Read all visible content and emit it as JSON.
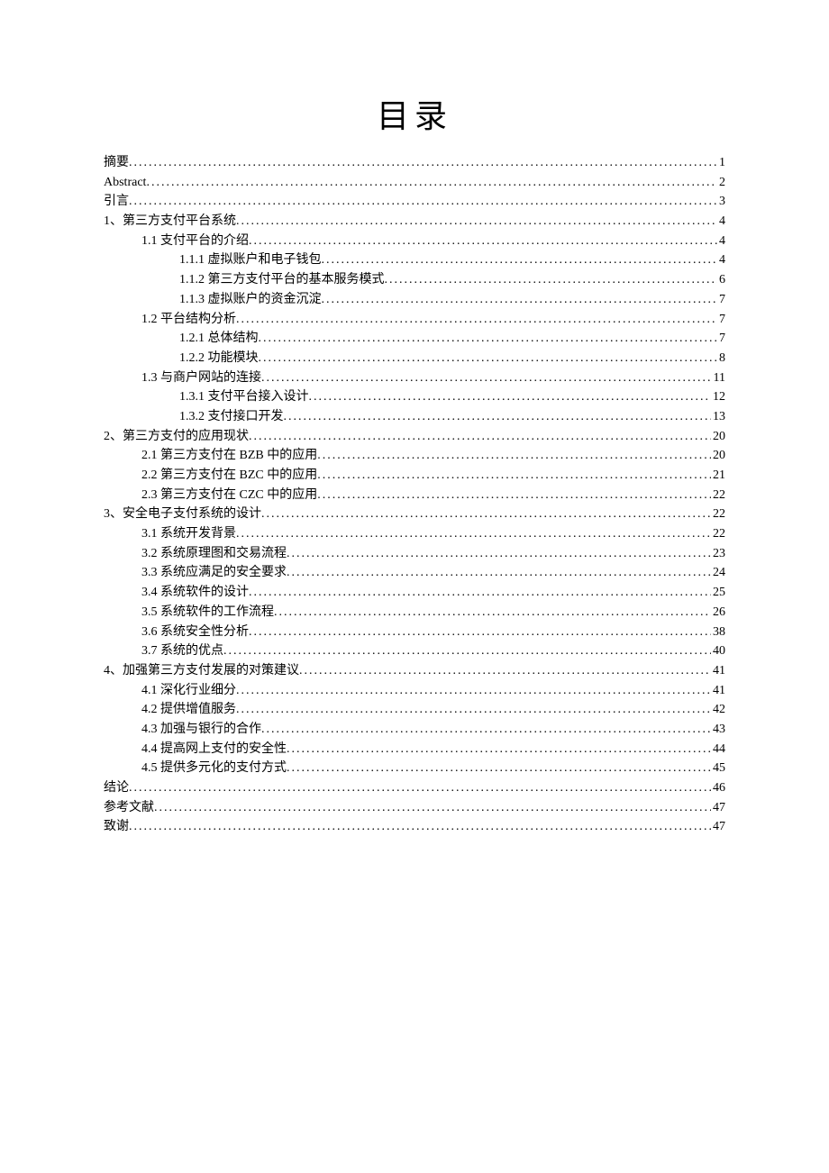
{
  "title": "目录",
  "entries": [
    {
      "label": "摘要",
      "page": "1",
      "level": 0
    },
    {
      "label": "Abstract",
      "page": "2",
      "level": 0
    },
    {
      "label": "引言",
      "page": "3",
      "level": 0
    },
    {
      "label": "1、第三方支付平台系统",
      "page": "4",
      "level": 0
    },
    {
      "label": "1.1 支付平台的介绍",
      "page": "4",
      "level": 1
    },
    {
      "label": "1.1.1 虚拟账户和电子钱包",
      "page": "4",
      "level": 2
    },
    {
      "label": "1.1.2 第三方支付平台的基本服务模式",
      "page": "6",
      "level": 2
    },
    {
      "label": "1.1.3 虚拟账户的资金沉淀",
      "page": "7",
      "level": 2
    },
    {
      "label": "1.2 平台结构分析",
      "page": "7",
      "level": 1
    },
    {
      "label": "1.2.1 总体结构",
      "page": "7",
      "level": 2
    },
    {
      "label": "1.2.2 功能模块",
      "page": "8",
      "level": 2
    },
    {
      "label": "1.3 与商户网站的连接",
      "page": "11",
      "level": 1
    },
    {
      "label": "1.3.1 支付平台接入设计",
      "page": "12",
      "level": 2
    },
    {
      "label": "1.3.2 支付接口开发",
      "page": "13",
      "level": 2
    },
    {
      "label": "2、第三方支付的应用现状",
      "page": "20",
      "level": 0
    },
    {
      "label": "2.1 第三方支付在 BZB 中的应用",
      "page": "20",
      "level": 1
    },
    {
      "label": "2.2 第三方支付在 BZC 中的应用",
      "page": "21",
      "level": 1
    },
    {
      "label": "2.3 第三方支付在 CZC 中的应用",
      "page": "22",
      "level": 1
    },
    {
      "label": "3、安全电子支付系统的设计",
      "page": "22",
      "level": 0
    },
    {
      "label": "3.1 系统开发背景",
      "page": "22",
      "level": 1
    },
    {
      "label": "3.2 系统原理图和交易流程",
      "page": "23",
      "level": 1
    },
    {
      "label": "3.3 系统应满足的安全要求",
      "page": "24",
      "level": 1
    },
    {
      "label": "3.4 系统软件的设计",
      "page": "25",
      "level": 1
    },
    {
      "label": "3.5 系统软件的工作流程",
      "page": "26",
      "level": 1
    },
    {
      "label": "3.6 系统安全性分析",
      "page": "38",
      "level": 1
    },
    {
      "label": "3.7 系统的优点",
      "page": "40",
      "level": 1
    },
    {
      "label": "4、加强第三方支付发展的对策建议",
      "page": "41",
      "level": 0
    },
    {
      "label": "4.1 深化行业细分",
      "page": "41",
      "level": 1
    },
    {
      "label": "4.2 提供增值服务",
      "page": "42",
      "level": 1
    },
    {
      "label": "4.3 加强与银行的合作",
      "page": "43",
      "level": 1
    },
    {
      "label": "4.4 提高网上支付的安全性",
      "page": "44",
      "level": 1
    },
    {
      "label": "4.5 提供多元化的支付方式",
      "page": "45",
      "level": 1
    },
    {
      "label": "结论",
      "page": "46",
      "level": 0
    },
    {
      "label": "参考文献",
      "page": "47",
      "level": 0
    },
    {
      "label": "致谢",
      "page": "47",
      "level": 0
    }
  ]
}
